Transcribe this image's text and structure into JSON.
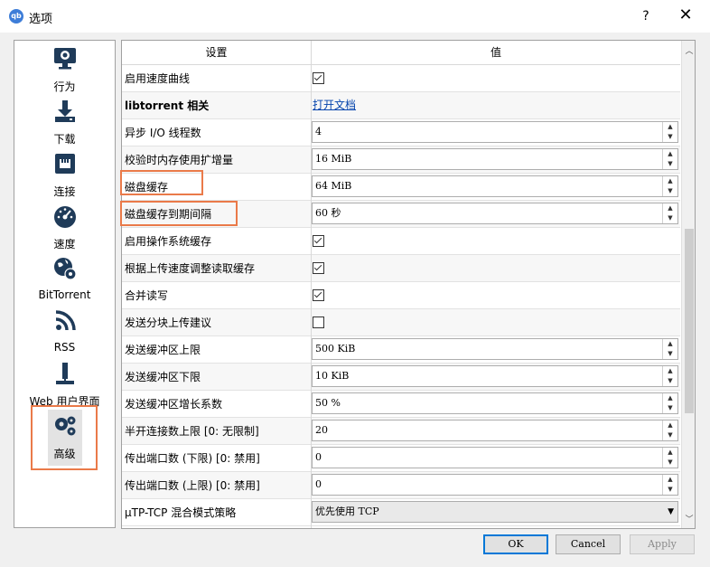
{
  "window": {
    "title": "选项",
    "app_icon": "qb",
    "help_label": "?",
    "close_label": "✕"
  },
  "sidebar": {
    "items": [
      {
        "label": "行为",
        "icon": "monitor-gear-icon"
      },
      {
        "label": "下载",
        "icon": "download-icon"
      },
      {
        "label": "连接",
        "icon": "network-port-icon"
      },
      {
        "label": "速度",
        "icon": "speedometer-icon"
      },
      {
        "label": "BitTorrent",
        "icon": "globe-gear-icon"
      },
      {
        "label": "RSS",
        "icon": "rss-icon"
      },
      {
        "label": "Web 用户界面",
        "icon": "web-ui-icon"
      },
      {
        "label": "高级",
        "icon": "gears-icon",
        "selected": true
      }
    ]
  },
  "table": {
    "header": {
      "setting": "设置",
      "value": "值"
    },
    "rows": [
      {
        "name": "启用速度曲线",
        "type": "checkbox",
        "checked": true
      },
      {
        "name": "libtorrent 相关",
        "type": "link",
        "value": "打开文档"
      },
      {
        "name": "异步 I/O 线程数",
        "type": "spin",
        "value": "4"
      },
      {
        "name": "校验时内存使用扩增量",
        "type": "spin",
        "value": "16 MiB"
      },
      {
        "name": "磁盘缓存",
        "type": "spin",
        "value": "64 MiB"
      },
      {
        "name": "磁盘缓存到期间隔",
        "type": "spin",
        "value": "60 秒"
      },
      {
        "name": "启用操作系统缓存",
        "type": "checkbox",
        "checked": true
      },
      {
        "name": "根据上传速度调整读取缓存",
        "type": "checkbox",
        "checked": true
      },
      {
        "name": "合并读写",
        "type": "checkbox",
        "checked": true
      },
      {
        "name": "发送分块上传建议",
        "type": "checkbox",
        "checked": false
      },
      {
        "name": "发送缓冲区上限",
        "type": "spin",
        "value": "500 KiB"
      },
      {
        "name": "发送缓冲区下限",
        "type": "spin",
        "value": "10 KiB"
      },
      {
        "name": "发送缓冲区增长系数",
        "type": "spin",
        "value": "50 %"
      },
      {
        "name": "半开连接数上限 [0: 无限制]",
        "type": "spin",
        "value": "20"
      },
      {
        "name": "传出端口数 (下限) [0: 禁用]",
        "type": "spin",
        "value": "0"
      },
      {
        "name": "传出端口数 (上限) [0: 禁用]",
        "type": "spin",
        "value": "0"
      },
      {
        "name": "µTP-TCP 混合模式策略",
        "type": "combo",
        "value": "优先使用 TCP"
      }
    ]
  },
  "buttons": {
    "ok": "OK",
    "cancel": "Cancel",
    "apply": "Apply"
  },
  "colors": {
    "highlight": "#ea7a49",
    "link": "#0645ad",
    "default_button": "#0078d7"
  }
}
